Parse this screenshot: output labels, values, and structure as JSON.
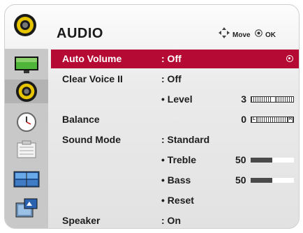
{
  "header": {
    "title": "AUDIO",
    "move_label": "Move",
    "ok_label": "OK"
  },
  "sidebar": [
    {
      "icon": "picture-icon",
      "active": false
    },
    {
      "icon": "audio-icon",
      "active": true
    },
    {
      "icon": "clock-icon",
      "active": false
    },
    {
      "icon": "setup-icon",
      "active": false
    },
    {
      "icon": "screen-icon",
      "active": false
    },
    {
      "icon": "input-icon",
      "active": false
    }
  ],
  "rows": [
    {
      "label": "Auto Volume",
      "value": ": Off",
      "selected": true
    },
    {
      "label": "Clear Voice II",
      "value": ": Off"
    },
    {
      "label": "",
      "value": "• Level",
      "number": "3",
      "slider": 0.5
    },
    {
      "label": "Balance",
      "value": "",
      "number": "0",
      "slider": 0.0
    },
    {
      "label": "Sound Mode",
      "value": ": Standard"
    },
    {
      "label": "",
      "value": "• Treble",
      "number": "50",
      "bar": 0.5
    },
    {
      "label": "",
      "value": "• Bass",
      "number": "50",
      "bar": 0.5
    },
    {
      "label": "",
      "value": "• Reset"
    },
    {
      "label": "Speaker",
      "value": ": On"
    }
  ],
  "slider_end_labels": {
    "balance_left": "L",
    "balance_right": "R"
  },
  "colors": {
    "selection": "#b50a34",
    "sidebar": "#c8c8c8"
  }
}
